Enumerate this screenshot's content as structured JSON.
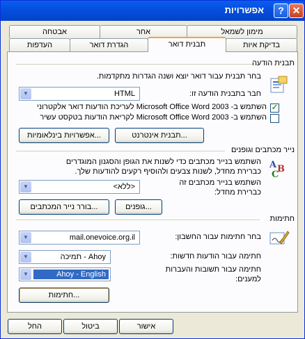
{
  "window": {
    "title": "אפשרויות",
    "help": "?",
    "close": "✕"
  },
  "tabs": {
    "row_back": [
      "מימון לשמאל",
      "אחר",
      "אבטחה"
    ],
    "row_front": [
      "בדיקת איות",
      "תבנית דואר",
      "הגדרת דואר",
      "העדפות"
    ]
  },
  "message_format": {
    "title": "תבנית הודעה",
    "desc": "בחר תבנית עבור דואר יוצא ושנה הגדרות מתקדמות.",
    "compose_label": "חבר בתבנית הודעה זו:",
    "compose_value": "HTML",
    "check1": "השתמש ב- Microsoft Office Word 2003 לעריכת הודעות דואר אלקטרוני",
    "check1_checked": "✓",
    "check2": "השתמש ב- Microsoft Office Word 2003 לקריאת הודעות בטקסט עשיר",
    "btn_internet": "תבנית אינטרנט...",
    "btn_international": "אפשרויות בינלאומיות..."
  },
  "stationery": {
    "title": "נייר מכתבים וגופנים",
    "desc1": "השתמש בנייר מכתבים כדי לשנות את הגופן והסגנון המוגדרים",
    "desc2": "כברירת מחדל, לשנות צבעים ולהוסיף רקעים להודעות שלך.",
    "use_label1": "השתמש בנייר מכתבים זה",
    "use_label2": "כברירת מחדל:",
    "use_value": "<ללא>",
    "btn_fonts": "גופנים...",
    "btn_picker": "בורר נייר המכתבים..."
  },
  "signatures": {
    "title": "חתימות",
    "account_label": "בחר חתימות עבור החשבון:",
    "account_value": "mail.onevoice.org.il",
    "new_label": "חתימה עבור הודעות חדשות:",
    "new_value": "תמיכה - Ahoy",
    "reply_label1": "חתימה עבור תשובות והעברות",
    "reply_label2": "למענים:",
    "reply_value": "Ahoy - English",
    "btn_signatures": "חתימות..."
  },
  "footer": {
    "ok": "אישור",
    "cancel": "ביטול",
    "apply": "החל"
  }
}
